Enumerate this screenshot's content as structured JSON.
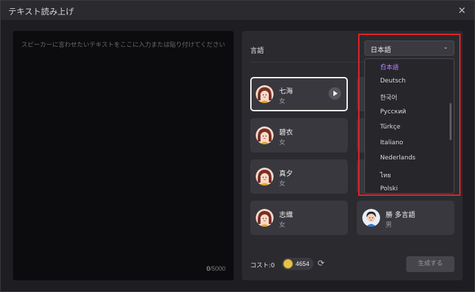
{
  "window": {
    "title": "テキスト読み上げ",
    "close_glyph": "✕"
  },
  "text_area": {
    "placeholder": "スピーカーに言わせたいテキストをここに入力または貼り付けてください",
    "count_current": "0",
    "count_max": "/5000"
  },
  "language": {
    "label": "言語",
    "selected": "日本語",
    "options": [
      "日本語",
      "Deutsch",
      "한국어",
      "Русский",
      "Türkçe",
      "Italiano",
      "Nederlands",
      "ไทย",
      "Polski"
    ]
  },
  "voices": [
    {
      "name": "七海",
      "gender": "女",
      "selected": true,
      "avatar": "female-avatar"
    },
    {
      "name": "碧衣",
      "gender": "女",
      "avatar": "female-avatar"
    },
    {
      "name": "真夕",
      "gender": "女",
      "avatar": "female-avatar"
    },
    {
      "name": "志織",
      "gender": "女",
      "avatar": "female-avatar"
    },
    {
      "name": "勝 多言語",
      "gender": "男",
      "avatar": "male-avatar"
    }
  ],
  "footer": {
    "cost_label": "コスト:0",
    "coins": "4654",
    "generate_label": "生成する"
  },
  "colors": {
    "accent": "#b57cff",
    "highlight": "#e0242a",
    "coin": "#e7c24a"
  }
}
